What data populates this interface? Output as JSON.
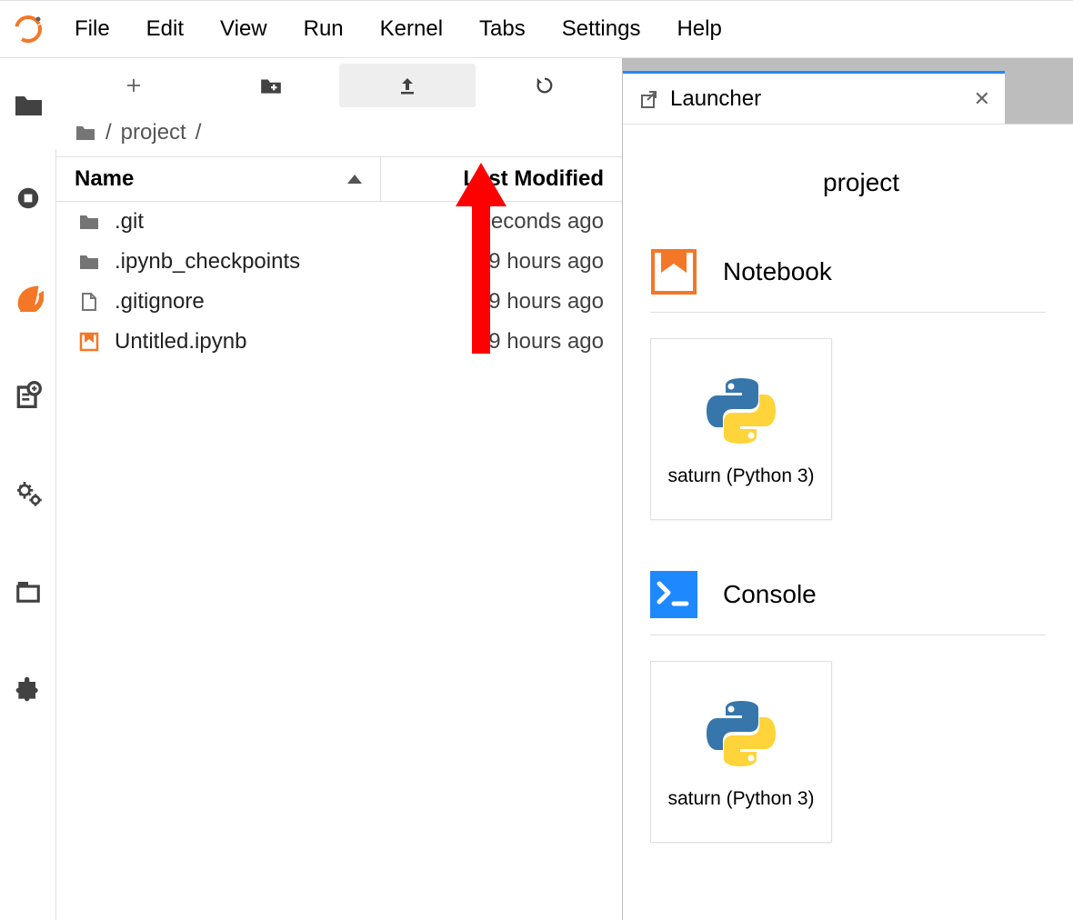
{
  "menu": [
    "File",
    "Edit",
    "View",
    "Run",
    "Kernel",
    "Tabs",
    "Settings",
    "Help"
  ],
  "breadcrumb": {
    "root": "/",
    "folder": "project",
    "trail": "/"
  },
  "columns": {
    "name": "Name",
    "modified": "Last Modified"
  },
  "files": [
    {
      "kind": "folder",
      "name": ".git",
      "modified": "seconds ago"
    },
    {
      "kind": "folder",
      "name": ".ipynb_checkpoints",
      "modified": "19 hours ago"
    },
    {
      "kind": "file",
      "name": ".gitignore",
      "modified": "19 hours ago"
    },
    {
      "kind": "notebook",
      "name": "Untitled.ipynb",
      "modified": "19 hours ago"
    }
  ],
  "tab": {
    "title": "Launcher"
  },
  "launcher": {
    "heading": "project",
    "sections": [
      {
        "icon": "notebook",
        "title": "Notebook",
        "cards": [
          {
            "kernel": "saturn (Python 3)"
          }
        ]
      },
      {
        "icon": "console",
        "title": "Console",
        "cards": [
          {
            "kernel": "saturn (Python 3)"
          }
        ]
      }
    ]
  },
  "colors": {
    "orange": "#f37726",
    "grey": "#616161",
    "folderGrey": "#757575"
  }
}
